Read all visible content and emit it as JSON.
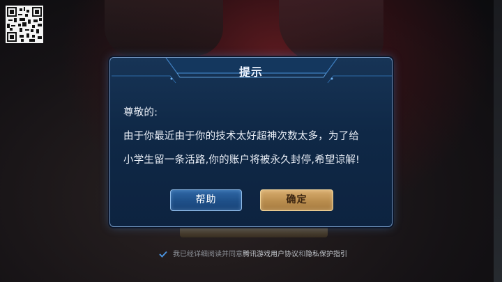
{
  "dialog": {
    "title": "提示",
    "greeting": "尊敬的:",
    "line1": "由于你最近由于你的技术太好超神次数太多，为了给",
    "line2": "小学生留一条活路,你的账户将被永久封停,希望谅解!",
    "help_label": "帮助",
    "confirm_label": "确定"
  },
  "agreement": {
    "prefix": "我已经详细阅读并同意",
    "link1": "腾讯游戏用户协议",
    "and": "和",
    "link2": "隐私保护指引"
  },
  "icons": {
    "qr": "qr-code-icon",
    "check": "checkmark-icon"
  },
  "colors": {
    "dialog_bg": "#0f2846",
    "dialog_border": "#6f93be",
    "help_button": "#1e4f88",
    "confirm_button": "#b98d4e",
    "check": "#4a90d9"
  }
}
